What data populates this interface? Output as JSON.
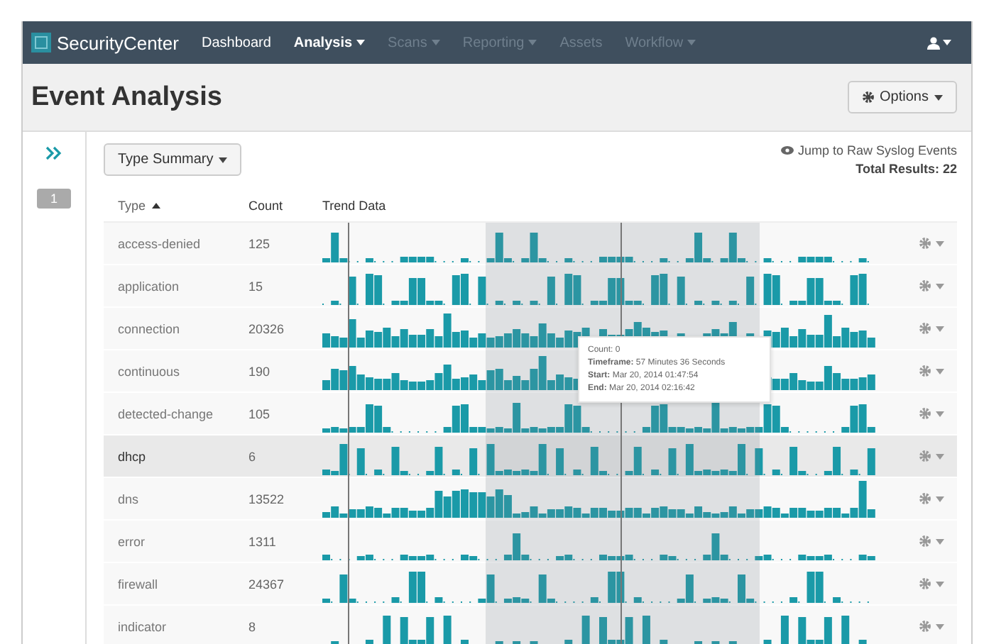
{
  "navbar": {
    "brand": "SecurityCenter",
    "items": [
      {
        "label": "Dashboard",
        "selected": false,
        "disabled": false,
        "caret": false
      },
      {
        "label": "Analysis",
        "selected": true,
        "disabled": false,
        "caret": true
      },
      {
        "label": "Scans",
        "selected": false,
        "disabled": true,
        "caret": true
      },
      {
        "label": "Reporting",
        "selected": false,
        "disabled": true,
        "caret": true
      },
      {
        "label": "Assets",
        "selected": false,
        "disabled": true,
        "caret": false
      },
      {
        "label": "Workflow",
        "selected": false,
        "disabled": true,
        "caret": true
      }
    ]
  },
  "page_title": "Event Analysis",
  "options_button": "Options",
  "sidebar": {
    "page_number": "1"
  },
  "view_dropdown": "Type Summary",
  "jump_link": "Jump to Raw Syslog Events",
  "total_results": "Total Results: 22",
  "table": {
    "columns": [
      "Type",
      "Count",
      "Trend Data"
    ],
    "rows": [
      {
        "type": "access-denied",
        "count": "125",
        "highlighted": false
      },
      {
        "type": "application",
        "count": "15",
        "highlighted": false
      },
      {
        "type": "connection",
        "count": "20326",
        "highlighted": false
      },
      {
        "type": "continuous",
        "count": "190",
        "highlighted": false
      },
      {
        "type": "detected-change",
        "count": "105",
        "highlighted": false
      },
      {
        "type": "dhcp",
        "count": "6",
        "highlighted": true
      },
      {
        "type": "dns",
        "count": "13522",
        "highlighted": false
      },
      {
        "type": "error",
        "count": "1311",
        "highlighted": false
      },
      {
        "type": "firewall",
        "count": "24367",
        "highlighted": false
      },
      {
        "type": "indicator",
        "count": "8",
        "highlighted": false
      }
    ]
  },
  "tooltip": {
    "count": "Count: 0",
    "lines": [
      "**Timeframe:** 57 Minutes 36 Seconds",
      "**Start:** Mar 20, 2014 01:47:54",
      "**End:** Mar 20, 2014 02:16:42"
    ]
  }
}
